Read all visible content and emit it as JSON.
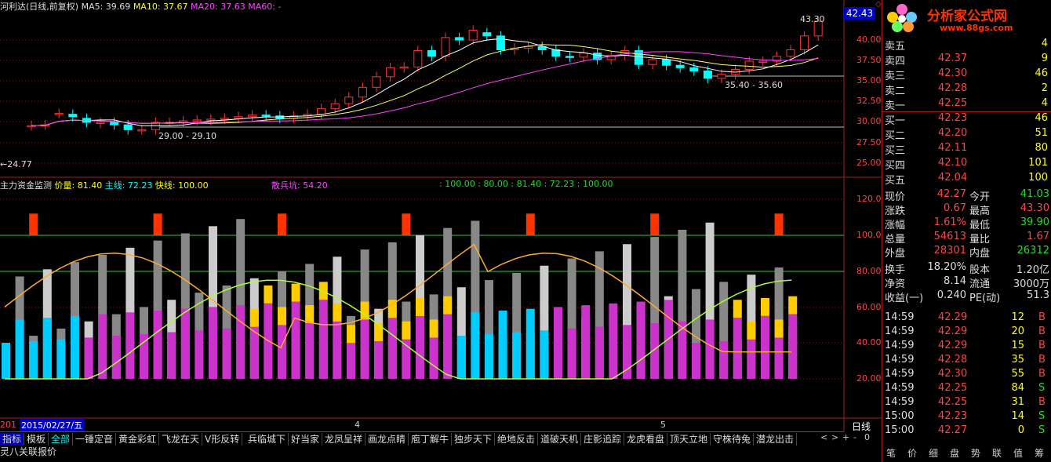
{
  "header": {
    "stock_title": "河利达(日线,前复权)",
    "ma5": "MA5: 39.69",
    "ma10": "MA10: 37.67",
    "ma20": "MA20: 37.63",
    "ma60": "MA60: -"
  },
  "price_panel": {
    "current_price_tag": "42.43",
    "axis_labels": [
      "40.00",
      "37.50",
      "35.00",
      "32.50",
      "30.00",
      "27.50",
      "25.00"
    ],
    "annotations": {
      "high": "43.30",
      "low_left": "24.77",
      "range1": "29.00 - 29.10",
      "range2": "35.40 - 35.60"
    }
  },
  "indicator_panel": {
    "name": "主力资金监测",
    "price_label": "价量: 81.40",
    "main_label": "主线: 72.23",
    "fast_label": "快线: 100.00",
    "scatter_label": "散兵坑: 54.20",
    "values_line": ": 100.00 : 80.00 : 81.40 : 72.23 : 100.00",
    "axis_labels": [
      "120.0",
      "100.0",
      "80.00",
      "60.00",
      "40.00",
      "20.00"
    ]
  },
  "time_axis": {
    "year": "201",
    "date_cursor": "2015/02/27/五",
    "month_4": "4",
    "month_5": "5",
    "period": "日线"
  },
  "bottom_tabs": [
    "指标",
    "模板",
    "全部",
    "一锤定音",
    "黄金彩虹",
    "飞龙在天",
    "V形反转",
    "兵临城下",
    "好当家",
    "龙凤呈祥",
    "画龙点睛",
    "庖丁解牛",
    "独步天下",
    "绝地反击",
    "道破天机",
    "庄影追踪",
    "龙虎看盘",
    "顶天立地",
    "守株待兔",
    "潜龙出击"
  ],
  "bottom_row2": [
    "灵八",
    "关联报价"
  ],
  "nav_buttons": [
    "<",
    ">",
    "+",
    "-",
    "0"
  ],
  "logo": {
    "main": "分析家公式网",
    "url": "www.88gs.com"
  },
  "order_book": {
    "sell": [
      {
        "label": "卖五",
        "price": "",
        "vol": "4"
      },
      {
        "label": "卖四",
        "price": "42.37",
        "vol": "9"
      },
      {
        "label": "卖三",
        "price": "42.30",
        "vol": "46"
      },
      {
        "label": "卖二",
        "price": "42.28",
        "vol": "2"
      },
      {
        "label": "卖一",
        "price": "42.25",
        "vol": "4"
      }
    ],
    "buy": [
      {
        "label": "买一",
        "price": "42.23",
        "vol": "46"
      },
      {
        "label": "买二",
        "price": "42.20",
        "vol": "51"
      },
      {
        "label": "买三",
        "price": "42.11",
        "vol": "80"
      },
      {
        "label": "买四",
        "price": "42.10",
        "vol": "101"
      },
      {
        "label": "买五",
        "price": "42.04",
        "vol": "100"
      }
    ]
  },
  "stats": [
    {
      "l1": "现价",
      "v1": "42.27",
      "l2": "今开",
      "v2": "41.03"
    },
    {
      "l1": "涨跌",
      "v1": "0.67",
      "l2": "最高",
      "v2": "43.30"
    },
    {
      "l1": "涨幅",
      "v1": "1.61%",
      "l2": "最低",
      "v2": "39.90"
    },
    {
      "l1": "总量",
      "v1": "54613",
      "l2": "量比",
      "v2": "1.67"
    },
    {
      "l1": "外盘",
      "v1": "28301",
      "l2": "内盘",
      "v2": "26312"
    },
    {
      "l1": "换手",
      "v1": "18.20%",
      "l2": "股本",
      "v2": "1.20亿"
    },
    {
      "l1": "净资",
      "v1": "8.14",
      "l2": "流通",
      "v2": "3000万"
    },
    {
      "l1": "收益(一)",
      "v1": "0.240",
      "l2": "PE(动)",
      "v2": "51.3"
    }
  ],
  "trades": [
    {
      "time": "14:59",
      "price": "42.29",
      "vol": "12",
      "bs": "B"
    },
    {
      "time": "14:59",
      "price": "42.29",
      "vol": "20",
      "bs": "B"
    },
    {
      "time": "14:59",
      "price": "42.29",
      "vol": "15",
      "bs": "B"
    },
    {
      "time": "14:59",
      "price": "42.28",
      "vol": "35",
      "bs": "B"
    },
    {
      "time": "14:59",
      "price": "42.30",
      "vol": "55",
      "bs": "B"
    },
    {
      "time": "14:59",
      "price": "42.25",
      "vol": "84",
      "bs": "S"
    },
    {
      "time": "14:59",
      "price": "42.25",
      "vol": "31",
      "bs": "B"
    },
    {
      "time": "15:00",
      "price": "42.23",
      "vol": "14",
      "bs": "S"
    },
    {
      "time": "15:00",
      "price": "42.27",
      "vol": "0",
      "bs": "S"
    }
  ],
  "right_tabs": [
    "笔",
    "价",
    "细",
    "盘",
    "势",
    "联",
    "值",
    "筹"
  ],
  "colors": {
    "up": "#ff3333",
    "down": "#00ffff",
    "ma5": "#ffffff",
    "ma10": "#ffff66",
    "ma20": "#ff44ff",
    "accent_blue": "#0000ff"
  }
}
